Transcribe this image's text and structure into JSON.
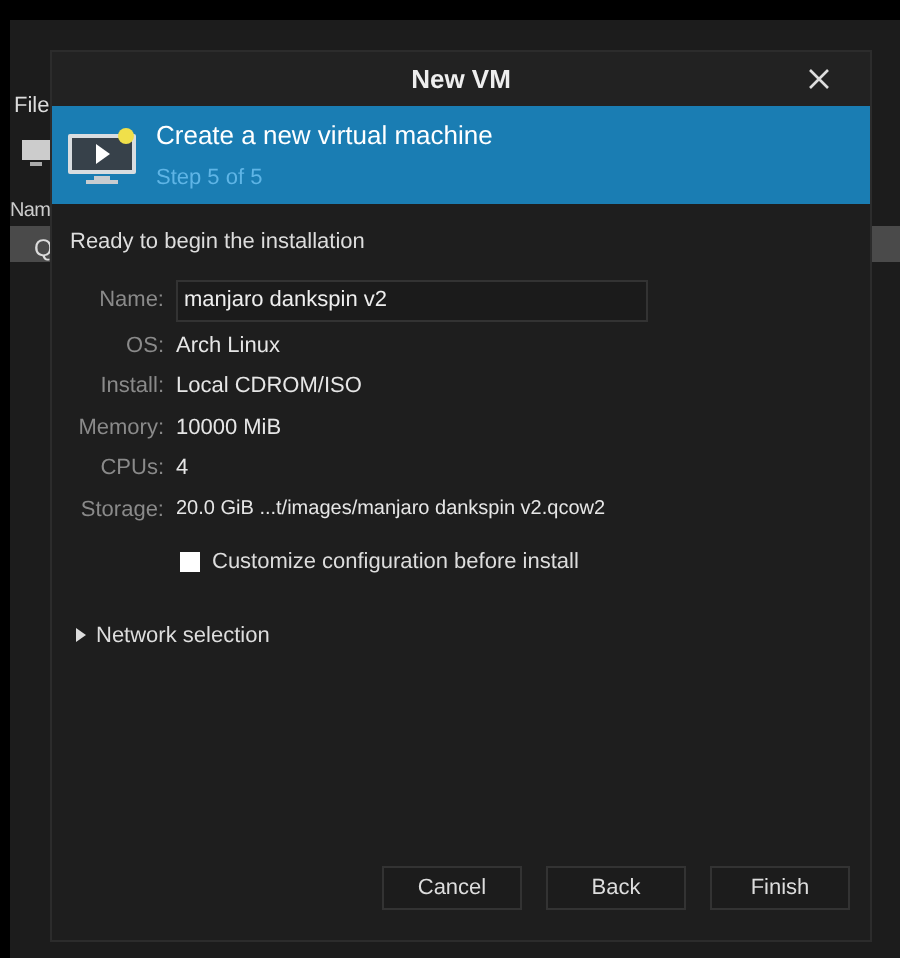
{
  "background_window": {
    "menu": "File",
    "column": "Nam",
    "row": "Q"
  },
  "dialog": {
    "title": "New VM",
    "banner": {
      "title": "Create a new virtual machine",
      "subtitle": "Step 5 of 5"
    },
    "heading": "Ready to begin the installation",
    "name": {
      "label": "Name:",
      "value": "manjaro dankspin v2"
    },
    "details": [
      {
        "label": "OS:",
        "value": "Arch Linux"
      },
      {
        "label": "Install:",
        "value": "Local CDROM/ISO"
      },
      {
        "label": "Memory:",
        "value": "10000 MiB"
      },
      {
        "label": "CPUs:",
        "value": "4"
      },
      {
        "label": "Storage:",
        "value": "20.0 GiB ...t/images/manjaro dankspin v2.qcow2"
      }
    ],
    "customize": {
      "label": "Customize configuration before install",
      "checked": false
    },
    "network": {
      "label": "Network selection",
      "expanded": false
    },
    "buttons": [
      "Cancel",
      "Back",
      "Finish"
    ]
  }
}
